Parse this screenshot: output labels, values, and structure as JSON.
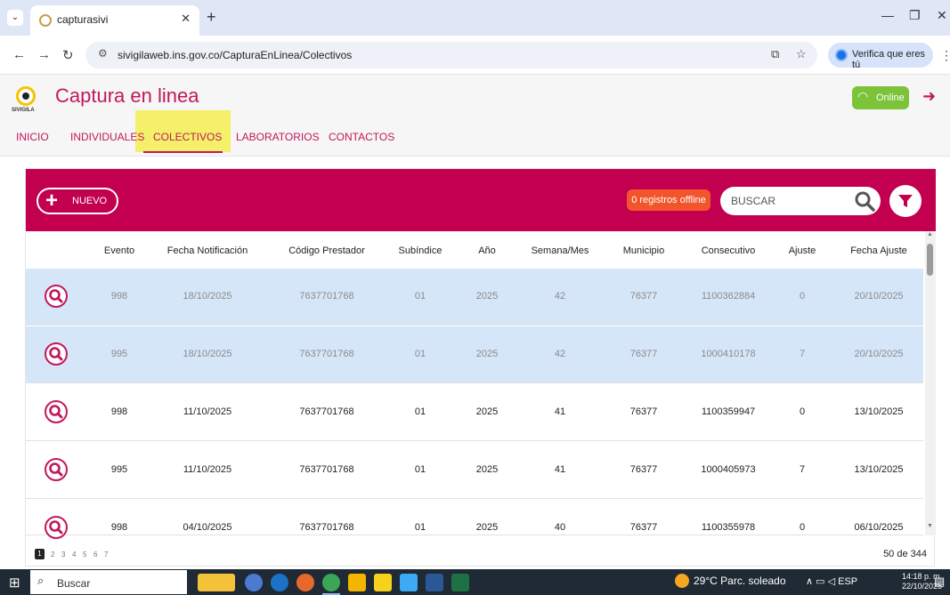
{
  "browser": {
    "tab_title": "capturasivi",
    "url": "sivigilaweb.ins.gov.co/CapturaEnLinea/Colectivos",
    "verify_label": "Verifica que eres tú"
  },
  "header": {
    "logo_text": "SIVIGILA",
    "title": "Captura en linea",
    "online_label": "Online"
  },
  "menu": [
    {
      "label": "INICIO"
    },
    {
      "label": "INDIVIDUALES"
    },
    {
      "label": "COLECTIVOS"
    },
    {
      "label": "LABORATORIOS"
    },
    {
      "label": "CONTACTOS"
    }
  ],
  "toolbar": {
    "new_label": "NUEVO",
    "offline_label": "0 registros offline",
    "search_placeholder": "BUSCAR"
  },
  "table": {
    "columns": [
      "Evento",
      "Fecha Notificación",
      "Código Prestador",
      "Subíndice",
      "Año",
      "Semana/Mes",
      "Municipio",
      "Consecutivo",
      "Ajuste",
      "Fecha Ajuste"
    ],
    "rows": [
      [
        "998",
        "18/10/2025",
        "7637701768",
        "01",
        "2025",
        "42",
        "76377",
        "1100362884",
        "0",
        "20/10/2025"
      ],
      [
        "995",
        "18/10/2025",
        "7637701768",
        "01",
        "2025",
        "42",
        "76377",
        "1000410178",
        "7",
        "20/10/2025"
      ],
      [
        "998",
        "11/10/2025",
        "7637701768",
        "01",
        "2025",
        "41",
        "76377",
        "1100359947",
        "0",
        "13/10/2025"
      ],
      [
        "995",
        "11/10/2025",
        "7637701768",
        "01",
        "2025",
        "41",
        "76377",
        "1000405973",
        "7",
        "13/10/2025"
      ],
      [
        "998",
        "04/10/2025",
        "7637701768",
        "01",
        "2025",
        "40",
        "76377",
        "1100355978",
        "0",
        "06/10/2025"
      ]
    ]
  },
  "pagination": {
    "pages": [
      "1",
      "2",
      "3",
      "4",
      "5",
      "6",
      "7"
    ],
    "count_label": "50 de 344"
  },
  "taskbar": {
    "search_label": "Buscar",
    "weather": "29°C  Parc. soleado",
    "lang": "ESP",
    "time": "14:18 p. m.",
    "date": "22/10/2025"
  },
  "colors": {
    "brand": "#c2185b",
    "panel_header": "#c2004f",
    "selected_row": "#d6e6f9",
    "online": "#7cc33a",
    "offline_badge": "#f2552c"
  }
}
